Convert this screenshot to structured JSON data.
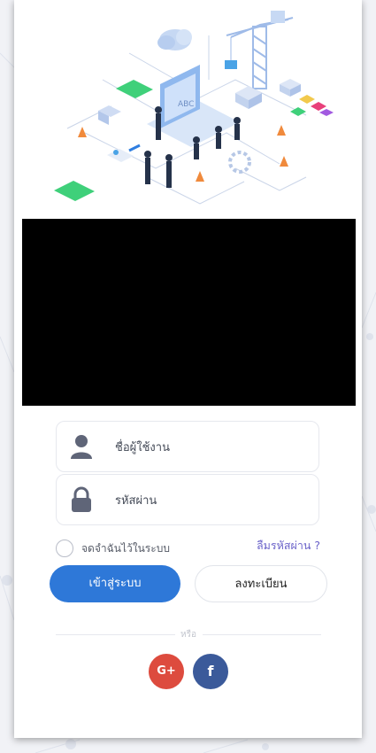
{
  "hero": {
    "screen_text": "ABC"
  },
  "video": {
    "state": "black"
  },
  "login": {
    "username_placeholder": "ชื่อผู้ใช้งาน",
    "password_placeholder": "รหัสผ่าน",
    "remember_label": "จดจำฉันไว้ในระบบ",
    "forgot_label": "ลืมรหัสผ่าน ?",
    "login_button": "เข้าสู่ระบบ",
    "register_button": "ลงทะเบียน",
    "or_text": "หรือ"
  },
  "social": {
    "google_label": "G+",
    "facebook_label": "f"
  },
  "icons": {
    "username": "user-icon",
    "password": "lock-icon",
    "google": "google-plus-icon",
    "facebook": "facebook-icon"
  },
  "colors": {
    "primary": "#2e78d8",
    "link": "#6b63c9",
    "google": "#dd4b3e",
    "facebook": "#3b5a9a",
    "icon": "#5f6578"
  }
}
